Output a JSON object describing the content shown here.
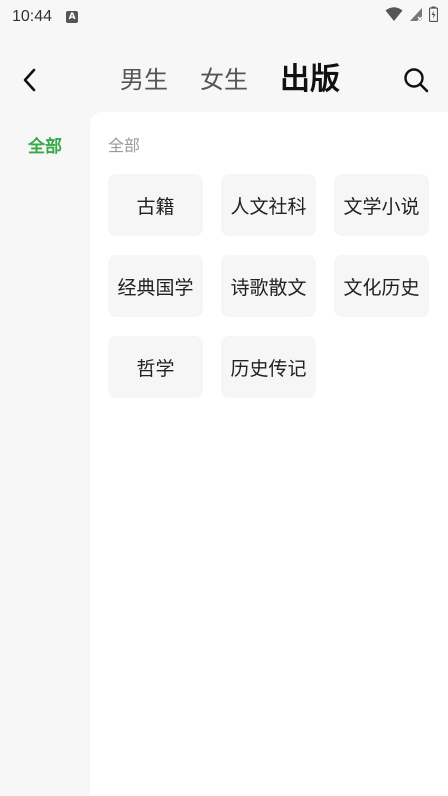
{
  "status_bar": {
    "time": "10:44",
    "notification_icon": "a-letter-icon"
  },
  "header": {
    "back_icon": "chevron-left-icon",
    "tabs": [
      {
        "label": "男生",
        "active": false
      },
      {
        "label": "女生",
        "active": false
      },
      {
        "label": "出版",
        "active": true
      }
    ],
    "search_icon": "search-icon"
  },
  "sidebar": {
    "items": [
      {
        "label": "全部",
        "selected": true
      }
    ]
  },
  "content": {
    "section_title": "全部",
    "categories": [
      "古籍",
      "人文社科",
      "文学小说",
      "经典国学",
      "诗歌散文",
      "文化历史",
      "哲学",
      "历史传记"
    ]
  },
  "colors": {
    "accent": "#3aa84b",
    "background": "#f7f7f7",
    "chip_bg": "#f6f6f6"
  }
}
